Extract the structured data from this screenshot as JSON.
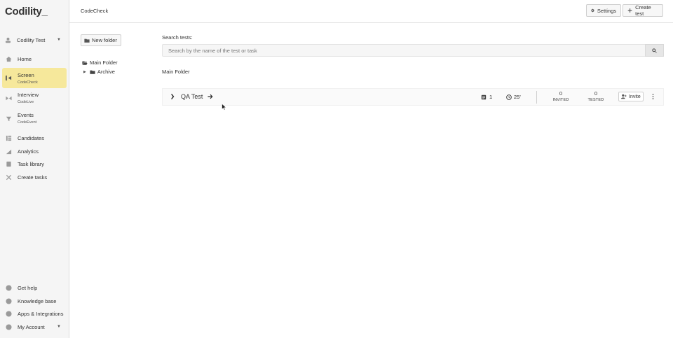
{
  "sidebar": {
    "logo": "Codility",
    "logo_suffix": "_",
    "workspace": "Codility Test",
    "items": [
      {
        "label": "Home",
        "sub": ""
      },
      {
        "label": "Screen",
        "sub": "CodeCheck"
      },
      {
        "label": "Interview",
        "sub": "CodeLive"
      },
      {
        "label": "Events",
        "sub": "CodeEvent"
      },
      {
        "label": "Candidates",
        "sub": ""
      },
      {
        "label": "Analytics",
        "sub": ""
      },
      {
        "label": "Task library",
        "sub": ""
      },
      {
        "label": "Create tasks",
        "sub": ""
      }
    ],
    "bottom": [
      {
        "label": "Get help"
      },
      {
        "label": "Knowledge base"
      },
      {
        "label": "Apps & Integrations"
      },
      {
        "label": "My Account"
      }
    ],
    "active_color": "#f6e89b"
  },
  "header": {
    "breadcrumb": "CodeCheck",
    "settings_label": "Settings",
    "create_test_label": "Create test"
  },
  "folders": {
    "new_folder_label": "New folder",
    "tree": [
      {
        "label": "Main Folder"
      },
      {
        "label": "Archive"
      }
    ]
  },
  "main": {
    "search_label": "Search tests:",
    "search_placeholder": "Search by the name of the test or task",
    "folder_title": "Main Folder",
    "tests": [
      {
        "name": "QA Test",
        "tasks": "1",
        "duration": "25'",
        "invited": "0",
        "invited_label": "INVITED",
        "tested": "0",
        "tested_label": "TESTED",
        "invite_label": "Invite"
      }
    ]
  }
}
